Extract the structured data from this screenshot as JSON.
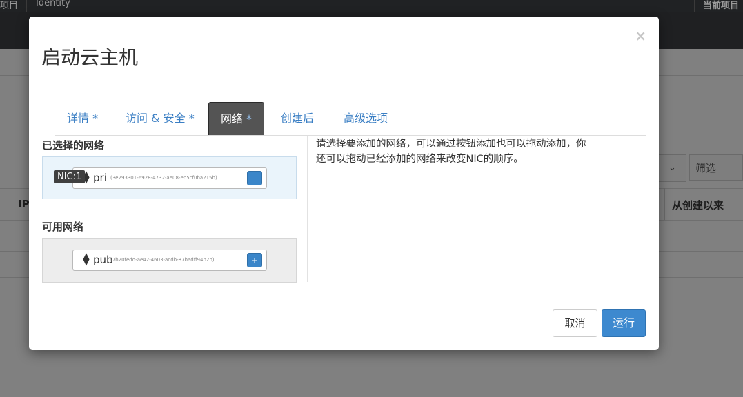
{
  "background": {
    "topbar": {
      "item_left": "项目",
      "item_identity": "Identity",
      "item_right": "当前项目"
    },
    "filter_placeholder": "筛选",
    "select_arrow": "⌄",
    "table_header_left": "IP",
    "table_header_right": "从创建以来"
  },
  "modal": {
    "title": "启动云主机",
    "close_glyph": "×",
    "tabs": [
      {
        "label": "详情",
        "required": " *"
      },
      {
        "label": "访问 & 安全",
        "required": " *"
      },
      {
        "label": "网络",
        "required": " *"
      },
      {
        "label": "创建后",
        "required": ""
      },
      {
        "label": "高级选项",
        "required": ""
      }
    ],
    "active_tab": "网络",
    "selected_section": {
      "title": "已选择的网络",
      "nic_badge": "NIC:1",
      "network": {
        "name": "pri",
        "id": "(3e293301-6928-4732-ae08-eb5cf0ba215b)",
        "action": "-"
      }
    },
    "available_section": {
      "title": "可用网络",
      "network": {
        "name": "pub",
        "id": "(7b20fedo-ae42-4603-acdb-87badff94b2b)",
        "action": "+"
      }
    },
    "help_text": "请选择要添加的网络，可以通过按钮添加也可以拖动添加，你还可以拖动已经添加的网络来改变NIC的顺序。",
    "footer": {
      "cancel": "取消",
      "submit": "运行"
    }
  },
  "icons": {
    "sort": "sort-updown-icon"
  },
  "colors": {
    "accent": "#3b7fc4",
    "primary_button": "#3d89cf",
    "active_tab_bg": "#545454"
  }
}
